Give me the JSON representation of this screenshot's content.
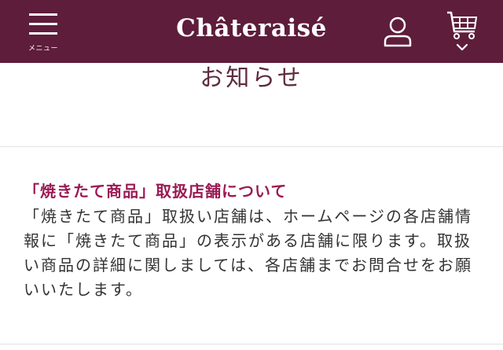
{
  "header": {
    "menu_label": "メニュー",
    "logo_text": "Châteraisé",
    "background_color": "#5e1d3b",
    "icons": [
      "hamburger-menu-icon",
      "user-icon",
      "cart-icon",
      "chevron-down-icon"
    ]
  },
  "page": {
    "title": "お知らせ"
  },
  "notice": {
    "heading": "「焼きたて商品」取扱店舗について",
    "body": "「焼きたて商品」取扱い店舗は、ホームページの各店舗情報に「焼きたて商品」の表示がある店舗に限ります。取扱い商品の詳細に関しましては、各店舗までお問合せをお願いいたします。",
    "heading_color": "#9b1a54"
  }
}
